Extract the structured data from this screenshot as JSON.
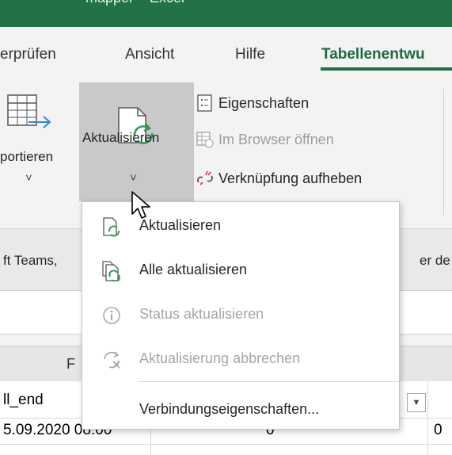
{
  "window": {
    "title_fragment": "mapper – Excel"
  },
  "ribbon_tabs": [
    {
      "label": "erprüfen"
    },
    {
      "label": "Ansicht"
    },
    {
      "label": "Hilfe"
    },
    {
      "label": "Tabellenentwu",
      "active": true
    }
  ],
  "ribbon": {
    "export_button": {
      "label": "portieren",
      "chevron": "˅"
    },
    "refresh_button": {
      "label": "Aktualisieren",
      "chevron": "˅"
    },
    "small_buttons": [
      {
        "label": "Eigenschaften",
        "icon": "properties-icon",
        "enabled": true
      },
      {
        "label": "Im Browser öffnen",
        "icon": "browser-open-icon",
        "enabled": false
      },
      {
        "label": "Verknüpfung aufheben",
        "icon": "unlink-icon",
        "enabled": true
      }
    ]
  },
  "info_bar": {
    "left_text": "ft Teams,",
    "right_text": "er de"
  },
  "column_header": {
    "label": "F"
  },
  "cells": {
    "header_left": "ll_end",
    "row1_date": "5.09.2020 08:00",
    "row1_val1": "0",
    "row1_val2": "0"
  },
  "dropdown": {
    "items": [
      {
        "label": "Aktualisieren",
        "icon": "refresh-icon",
        "enabled": true
      },
      {
        "label": "Alle aktualisieren",
        "icon": "refresh-all-icon",
        "enabled": true
      },
      {
        "label": "Status aktualisieren",
        "icon": "info-icon",
        "enabled": false
      },
      {
        "label": "Aktualisierung abbrechen",
        "icon": "cancel-refresh-icon",
        "enabled": false
      },
      {
        "label": "Verbindungseigenschaften...",
        "icon": "",
        "enabled": true
      }
    ]
  },
  "colors": {
    "accent": "#217346",
    "active_tab": "#1e6b40",
    "refresh_green": "#2e9a4e",
    "disabled": "#a6a6a6"
  }
}
